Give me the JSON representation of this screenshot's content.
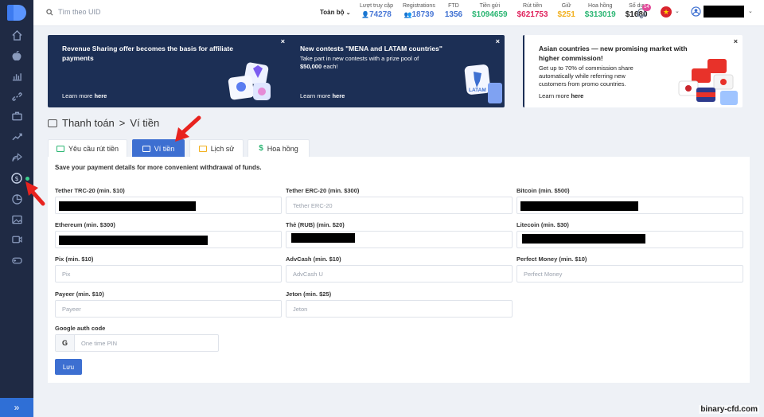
{
  "colors": {
    "sidebar": "#1f2a44",
    "accent": "#3d6fd1",
    "banner_dark": "#1c2f55"
  },
  "sidebar": {
    "icons": [
      "home-icon",
      "apple-icon",
      "bar-chart-icon",
      "link-icon",
      "briefcase-icon",
      "trend-icon",
      "share-icon",
      "dollar-icon",
      "pie-chart-icon",
      "image-icon",
      "video-icon",
      "gamepad-icon"
    ],
    "expand_icon": "chevron-double-right-icon",
    "expand_label": "»"
  },
  "topbar": {
    "search_placeholder": "Tìm theo UID",
    "range_label": "Toàn bộ",
    "stats": [
      {
        "label": "Lượt truy cập",
        "value": "74278",
        "color": "#4a78d6"
      },
      {
        "label": "Registrations",
        "value": "18739",
        "color": "#4a78d6"
      },
      {
        "label": "FTD",
        "value": "1356",
        "color": "#3d6fd1"
      },
      {
        "label": "Tiền gửi",
        "value": "$1094659",
        "color": "#2bb673"
      },
      {
        "label": "Rút tiền",
        "value": "$621753",
        "color": "#e0245e"
      },
      {
        "label": "Giữ",
        "value": "$251",
        "color": "#f2b01e"
      },
      {
        "label": "Hoa hồng",
        "value": "$313019",
        "color": "#2bb673"
      },
      {
        "label": "Số dư",
        "value": "$1680",
        "color": "#222222"
      }
    ],
    "notifications_count": "14"
  },
  "banners": [
    {
      "title": "Revenue Sharing offer becomes the basis for affiliate payments",
      "text": "",
      "link_prefix": "Learn more ",
      "link": "here",
      "close": "×"
    },
    {
      "title": "New contests \"MENA and LATAM countries\"",
      "text_pre": "Take part in new contests with a prize pool of ",
      "text_bold": "$50,000",
      "text_post": " each!",
      "badge": "LATAM",
      "link_prefix": "Learn more ",
      "link": "here",
      "close": "×"
    },
    {
      "title": "Asian countries — new promising market with higher commission!",
      "text": "Get up to 70% of commission share automatically while referring new customers from promo countries.",
      "link_prefix": "Learn more ",
      "link": "here",
      "close": "×"
    }
  ],
  "page": {
    "title": "Thanh toán",
    "separator": ">",
    "subtitle": "Ví tiền"
  },
  "tabs": [
    {
      "label": "Yêu cầu rút tiền",
      "active": false
    },
    {
      "label": "Ví tiền",
      "active": true
    },
    {
      "label": "Lịch sử",
      "active": false
    },
    {
      "label": "Hoa hồng",
      "active": false
    }
  ],
  "form": {
    "intro": "Save your payment details for more convenient withdrawal of funds.",
    "fields": [
      {
        "label": "Tether TRC-20 (min. $10)",
        "placeholder": "",
        "redacted": true
      },
      {
        "label": "Tether ERC-20 (min. $300)",
        "placeholder": "Tether ERC-20",
        "redacted": false
      },
      {
        "label": "Bitcoin (min. $500)",
        "placeholder": "",
        "redacted": true
      },
      {
        "label": "Ethereum (min. $300)",
        "placeholder": "",
        "redacted": true
      },
      {
        "label": "Thẻ (RUB) (min. $20)",
        "placeholder": "",
        "redacted": true
      },
      {
        "label": "Litecoin (min. $30)",
        "placeholder": "",
        "redacted": true
      },
      {
        "label": "Pix (min. $10)",
        "placeholder": "Pix",
        "redacted": false
      },
      {
        "label": "AdvCash (min. $10)",
        "placeholder": "AdvCash U",
        "redacted": false
      },
      {
        "label": "Perfect Money (min. $10)",
        "placeholder": "Perfect Money",
        "redacted": false
      },
      {
        "label": "Payeer (min. $10)",
        "placeholder": "Payeer",
        "redacted": false
      },
      {
        "label": "Jeton (min. $25)",
        "placeholder": "Jeton",
        "redacted": false
      }
    ],
    "google_auth": {
      "label": "Google auth code",
      "prefix": "G",
      "placeholder": "One time PIN"
    },
    "save_label": "Lưu"
  },
  "watermark": "binary-cfd.com"
}
